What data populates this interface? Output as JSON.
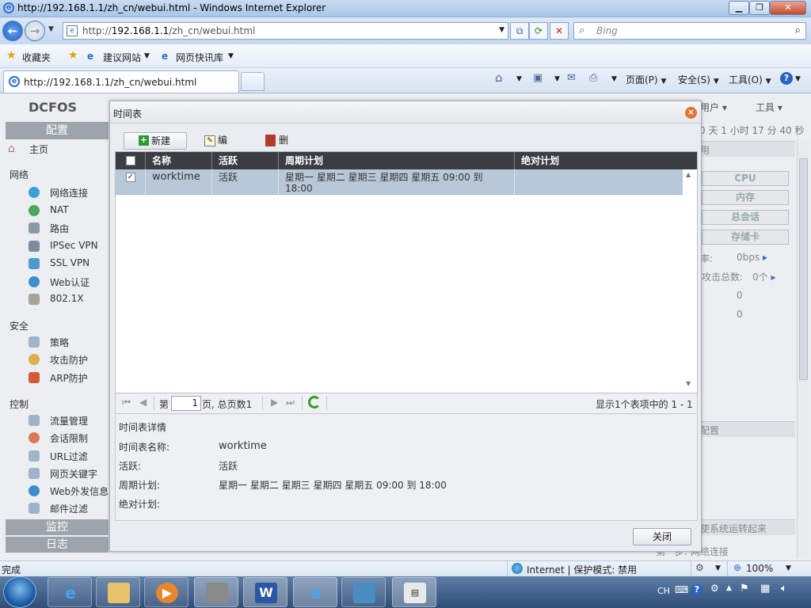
{
  "window": {
    "title": "http://192.168.1.1/zh_cn/webui.html - Windows Internet Explorer"
  },
  "address": {
    "prefix": "http://",
    "host": "192.168.1.1",
    "path": "/zh_cn/webui.html"
  },
  "search": {
    "placeholder": "Bing"
  },
  "favbar": {
    "favorites": "收藏夹",
    "suggested": "建议网站",
    "webslice": "网页快讯库"
  },
  "tab": {
    "title": "http://192.168.1.1/zh_cn/webui.html"
  },
  "commands": {
    "page": "页面(P)",
    "safety": "安全(S)",
    "tools": "工具(O)"
  },
  "app": {
    "logo": "DCFOS",
    "config_header": "配置",
    "home": "主页",
    "groups": {
      "network": "网络",
      "security": "安全",
      "control": "控制"
    },
    "network_items": [
      "网络连接",
      "NAT",
      "路由",
      "IPSec VPN",
      "SSL VPN",
      "Web认证",
      "802.1X"
    ],
    "security_items": [
      "策略",
      "攻击防护",
      "ARP防护"
    ],
    "control_items": [
      "流量管理",
      "会话限制",
      "URL过滤",
      "网页关键字",
      "Web外发信息",
      "邮件过滤"
    ],
    "monitor": "监控",
    "log": "日志",
    "top_user": "用户 ▾",
    "top_tools": "工具 ▾",
    "uptime": "0 天 1 小时 17 分 40 秒",
    "right_header": "用",
    "res_buttons": [
      "CPU",
      "内存",
      "总会话",
      "存储卡"
    ],
    "rate_label": "率:",
    "rate_value": "0bps",
    "attack_label": "攻击总数:",
    "attack_value": "0个",
    "zero1": "0",
    "zero2": "0",
    "config_section": "配置",
    "hint1": "使系统运转起来",
    "hint2": "第一步: 网络连接"
  },
  "modal": {
    "title": "时间表",
    "toolbar": {
      "new": "新建",
      "edit": "编辑",
      "delete": "删除"
    },
    "columns": [
      "名称",
      "活跃",
      "周期计划",
      "绝对计划"
    ],
    "rows": [
      {
        "name": "worktime",
        "active": "活跃",
        "periodic": "星期一 星期二 星期三 星期四 星期五 09:00 到 18:00",
        "absolute": "",
        "checked": true
      }
    ],
    "pager": {
      "page_prefix": "第",
      "page_value": "1",
      "page_suffix": "页, 总页数1",
      "summary": "显示1个表项中的 1 - 1"
    },
    "detail": {
      "heading": "时间表详情",
      "name_label": "时间表名称:",
      "name_value": "worktime",
      "active_label": "活跃:",
      "active_value": "活跃",
      "periodic_label": "周期计划:",
      "periodic_value": "星期一 星期二 星期三 星期四 星期五 09:00 到 18:00",
      "absolute_label": "绝对计划:",
      "absolute_value": ""
    },
    "close_button": "关闭"
  },
  "status": {
    "text": "完成",
    "zone": "Internet | 保护模式: 禁用",
    "zoom": "100%"
  },
  "taskbar": {
    "lang": "CH"
  }
}
